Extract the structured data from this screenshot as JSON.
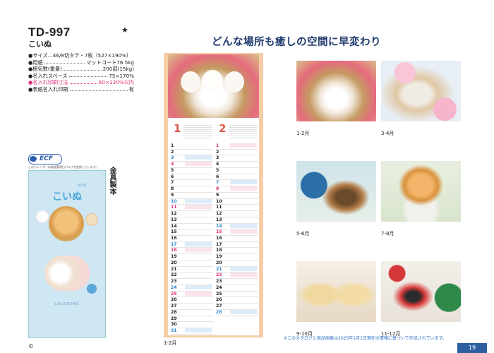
{
  "product": {
    "code": "TD-997",
    "star": "★",
    "name": "こいぬ",
    "specs": [
      {
        "label": "●サイズ…46/8切タテ・7枚（527×190%）",
        "value": ""
      },
      {
        "label": "●用紙",
        "value": "マットコート76.5kg"
      },
      {
        "label": "●梱包数(重量)",
        "value": "200部(15kg)"
      },
      {
        "label": "●名入れスペース",
        "value": "75×170%"
      },
      {
        "label": "●名入れ印刷寸法",
        "value": "60×130%以内"
      },
      {
        "label": "●表紙名入れ印刷",
        "value": "有"
      }
    ],
    "ecf_label": "ECF",
    "ecf_note": "このカレンダーは無塩素漂白パルプを使用しています。",
    "binding": "金具製本",
    "cover_title": "こいぬ",
    "cover_year": "2026",
    "cover_calendar": "CALENDAR",
    "copyright": "©"
  },
  "headline": "どんな場所も癒しの空間に早変わり",
  "calendar": {
    "month1": "1",
    "month2": "2",
    "caption": "1-2月",
    "days1": [
      "1",
      "2",
      "3",
      "4",
      "5",
      "6",
      "7",
      "8",
      "9",
      "10",
      "11",
      "12",
      "13",
      "14",
      "15",
      "16",
      "17",
      "18",
      "19",
      "20",
      "21",
      "22",
      "23",
      "24",
      "25",
      "26",
      "27",
      "28",
      "29",
      "30",
      "31"
    ],
    "days2": [
      "1",
      "2",
      "3",
      "4",
      "5",
      "6",
      "7",
      "8",
      "9",
      "10",
      "11",
      "12",
      "13",
      "14",
      "15",
      "16",
      "17",
      "18",
      "19",
      "20",
      "21",
      "22",
      "23",
      "24",
      "25",
      "26",
      "27",
      "28"
    ]
  },
  "thumbs": [
    {
      "caption": "1-2月",
      "icon": "puppies-in-basket"
    },
    {
      "caption": "3-4月",
      "icon": "shiba-with-blossoms"
    },
    {
      "caption": "5-6月",
      "icon": "yorkie-with-kettle"
    },
    {
      "caption": "7-8月",
      "icon": "pomeranian-in-bowl"
    },
    {
      "caption": "9-10月",
      "icon": "two-retriever-puppies"
    },
    {
      "caption": "11-12月",
      "icon": "pug-christmas"
    }
  ],
  "footnote": "※このカタログと商品画像は2025年1月1日現在の情報に基づいて作成されています。",
  "page_number": "19",
  "colors": {
    "headline": "#1f3a6d",
    "pink": "#e0307c",
    "blue": "#2e86d0",
    "calendar_frame": "#f6cda8"
  }
}
